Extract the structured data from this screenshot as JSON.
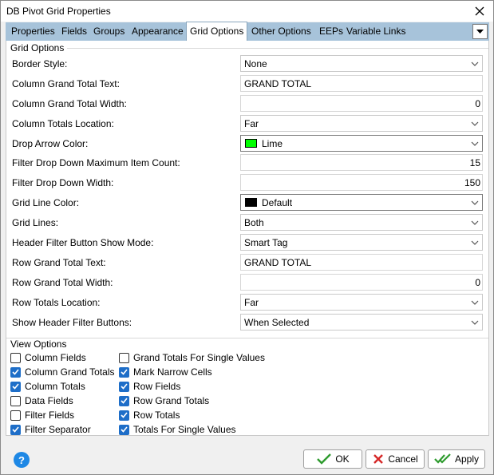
{
  "window": {
    "title": "DB Pivot Grid Properties"
  },
  "tabs": [
    {
      "label": "Properties"
    },
    {
      "label": "Fields"
    },
    {
      "label": "Groups"
    },
    {
      "label": "Appearance"
    },
    {
      "label": "Grid Options",
      "active": true
    },
    {
      "label": "Other Options"
    },
    {
      "label": "EEPs"
    },
    {
      "label": "Variable Links"
    }
  ],
  "grid_options": {
    "section_title": "Grid Options",
    "rows": [
      {
        "label": "Border Style:",
        "value": "None",
        "control": "dropdown"
      },
      {
        "label": "Column Grand Total Text:",
        "value": "GRAND TOTAL",
        "control": "text"
      },
      {
        "label": "Column Grand Total Width:",
        "value": "0",
        "control": "number"
      },
      {
        "label": "Column Totals Location:",
        "value": "Far",
        "control": "dropdown"
      },
      {
        "label": "Drop Arrow Color:",
        "value": "Lime",
        "control": "color",
        "color": "#00ff00"
      },
      {
        "label": "Filter Drop Down Maximum Item Count:",
        "value": "15",
        "control": "number"
      },
      {
        "label": "Filter Drop Down Width:",
        "value": "150",
        "control": "number"
      },
      {
        "label": "Grid Line Color:",
        "value": "Default",
        "control": "color",
        "color": "#000000"
      },
      {
        "label": "Grid Lines:",
        "value": "Both",
        "control": "dropdown"
      },
      {
        "label": "Header Filter Button Show Mode:",
        "value": "Smart Tag",
        "control": "dropdown"
      },
      {
        "label": "Row Grand Total Text:",
        "value": "GRAND TOTAL",
        "control": "text"
      },
      {
        "label": "Row Grand Total Width:",
        "value": "0",
        "control": "number"
      },
      {
        "label": "Row Totals Location:",
        "value": "Far",
        "control": "dropdown"
      },
      {
        "label": "Show Header Filter Buttons:",
        "value": "When Selected",
        "control": "dropdown"
      }
    ]
  },
  "view_options": {
    "section_title": "View Options",
    "left": [
      {
        "label": "Column Fields",
        "checked": false
      },
      {
        "label": "Column Grand Totals",
        "checked": true
      },
      {
        "label": "Column Totals",
        "checked": true
      },
      {
        "label": "Data Fields",
        "checked": false
      },
      {
        "label": "Filter Fields",
        "checked": false
      },
      {
        "label": "Filter Separator",
        "checked": true
      }
    ],
    "right": [
      {
        "label": "Grand Totals For Single Values",
        "checked": false
      },
      {
        "label": "Mark Narrow Cells",
        "checked": true
      },
      {
        "label": "Row Fields",
        "checked": true
      },
      {
        "label": "Row Grand Totals",
        "checked": true
      },
      {
        "label": "Row Totals",
        "checked": true
      },
      {
        "label": "Totals For Single Values",
        "checked": true
      }
    ]
  },
  "footer": {
    "help": "?",
    "ok": "OK",
    "cancel": "Cancel",
    "apply": "Apply"
  },
  "colors": {
    "tab_strip": "#a7c3da",
    "accent": "#1e6ec8",
    "ok_check": "#2e9b2e",
    "cancel_x": "#d62828"
  }
}
